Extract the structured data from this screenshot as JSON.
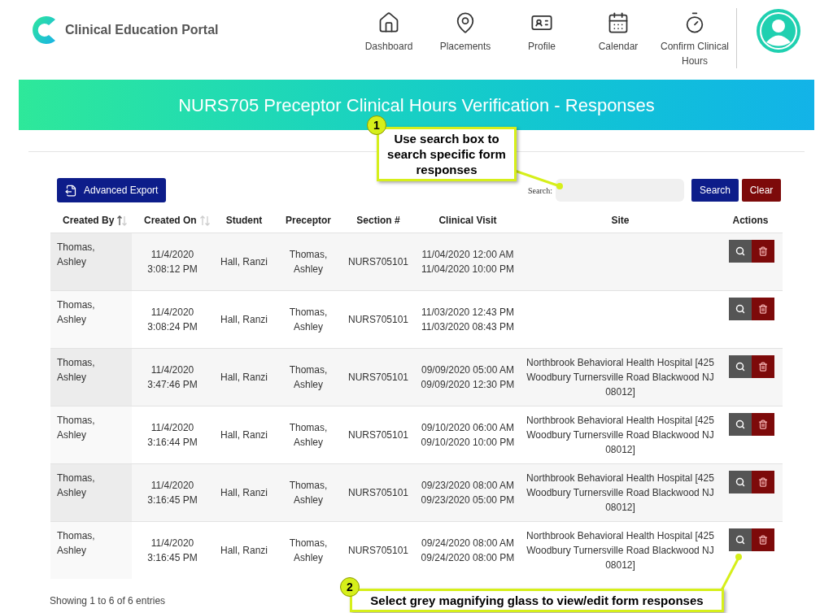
{
  "header": {
    "logo_text": "Clinical Education Portal",
    "nav": [
      {
        "kind": "home",
        "label": "Dashboard"
      },
      {
        "kind": "pin",
        "label": "Placements"
      },
      {
        "kind": "card",
        "label": "Profile"
      },
      {
        "kind": "calendar",
        "label": "Calendar"
      },
      {
        "kind": "timer",
        "label": "Confirm Clinical Hours"
      }
    ]
  },
  "banner": {
    "title": "NURS705 Preceptor Clinical Hours Verification - Responses"
  },
  "toolbar": {
    "export_button": "Advanced Export",
    "search_label": "Search:",
    "search_button": "Search",
    "clear_button": "Clear"
  },
  "table": {
    "columns": [
      {
        "label": "Created By",
        "sorted": true
      },
      {
        "label": "Created On",
        "sorted": false
      },
      {
        "label": "Student"
      },
      {
        "label": "Preceptor"
      },
      {
        "label": "Section #"
      },
      {
        "label": "Clinical Visit"
      },
      {
        "label": "Site"
      },
      {
        "label": "Actions"
      }
    ],
    "rows": [
      [
        "Thomas, Ashley",
        "11/4/2020 3:08:12 PM",
        "Hall, Ranzi",
        "Thomas, Ashley",
        "NURS705101",
        "11/04/2020 12:00 AM 11/04/2020 10:00 PM",
        ""
      ],
      [
        "Thomas, Ashley",
        "11/4/2020 3:08:24 PM",
        "Hall, Ranzi",
        "Thomas, Ashley",
        "NURS705101",
        "11/03/2020 12:43 PM 11/03/2020 08:43 PM",
        ""
      ],
      [
        "Thomas, Ashley",
        "11/4/2020 3:47:46 PM",
        "Hall, Ranzi",
        "Thomas, Ashley",
        "NURS705101",
        "09/09/2020 05:00 AM 09/09/2020 12:30 PM",
        "Northbrook Behavioral Health Hospital [425 Woodbury Turnersville Road  Blackwood NJ 08012]"
      ],
      [
        "Thomas, Ashley",
        "11/4/2020 3:16:44 PM",
        "Hall, Ranzi",
        "Thomas, Ashley",
        "NURS705101",
        "09/10/2020 06:00 AM 09/10/2020 10:00 PM",
        "Northbrook Behavioral Health Hospital [425 Woodbury Turnersville Road  Blackwood NJ 08012]"
      ],
      [
        "Thomas, Ashley",
        "11/4/2020 3:16:45 PM",
        "Hall, Ranzi",
        "Thomas, Ashley",
        "NURS705101",
        "09/23/2020 08:00 AM 09/23/2020 05:00 PM",
        "Northbrook Behavioral Health Hospital [425 Woodbury Turnersville Road  Blackwood NJ 08012]"
      ],
      [
        "Thomas, Ashley",
        "11/4/2020 3:16:45 PM",
        "Hall, Ranzi",
        "Thomas, Ashley",
        "NURS705101",
        "09/24/2020 08:00 AM 09/24/2020 08:00 PM",
        "Northbrook Behavioral Health Hospital [425 Woodbury Turnersville Road  Blackwood NJ 08012]"
      ]
    ],
    "info": "Showing 1 to 6 of 6 entries"
  },
  "callouts": [
    {
      "number": "1",
      "text": "Use search box to search specific form responses"
    },
    {
      "number": "2",
      "text": "Select grey magnifying glass to view/edit  form responses"
    }
  ]
}
